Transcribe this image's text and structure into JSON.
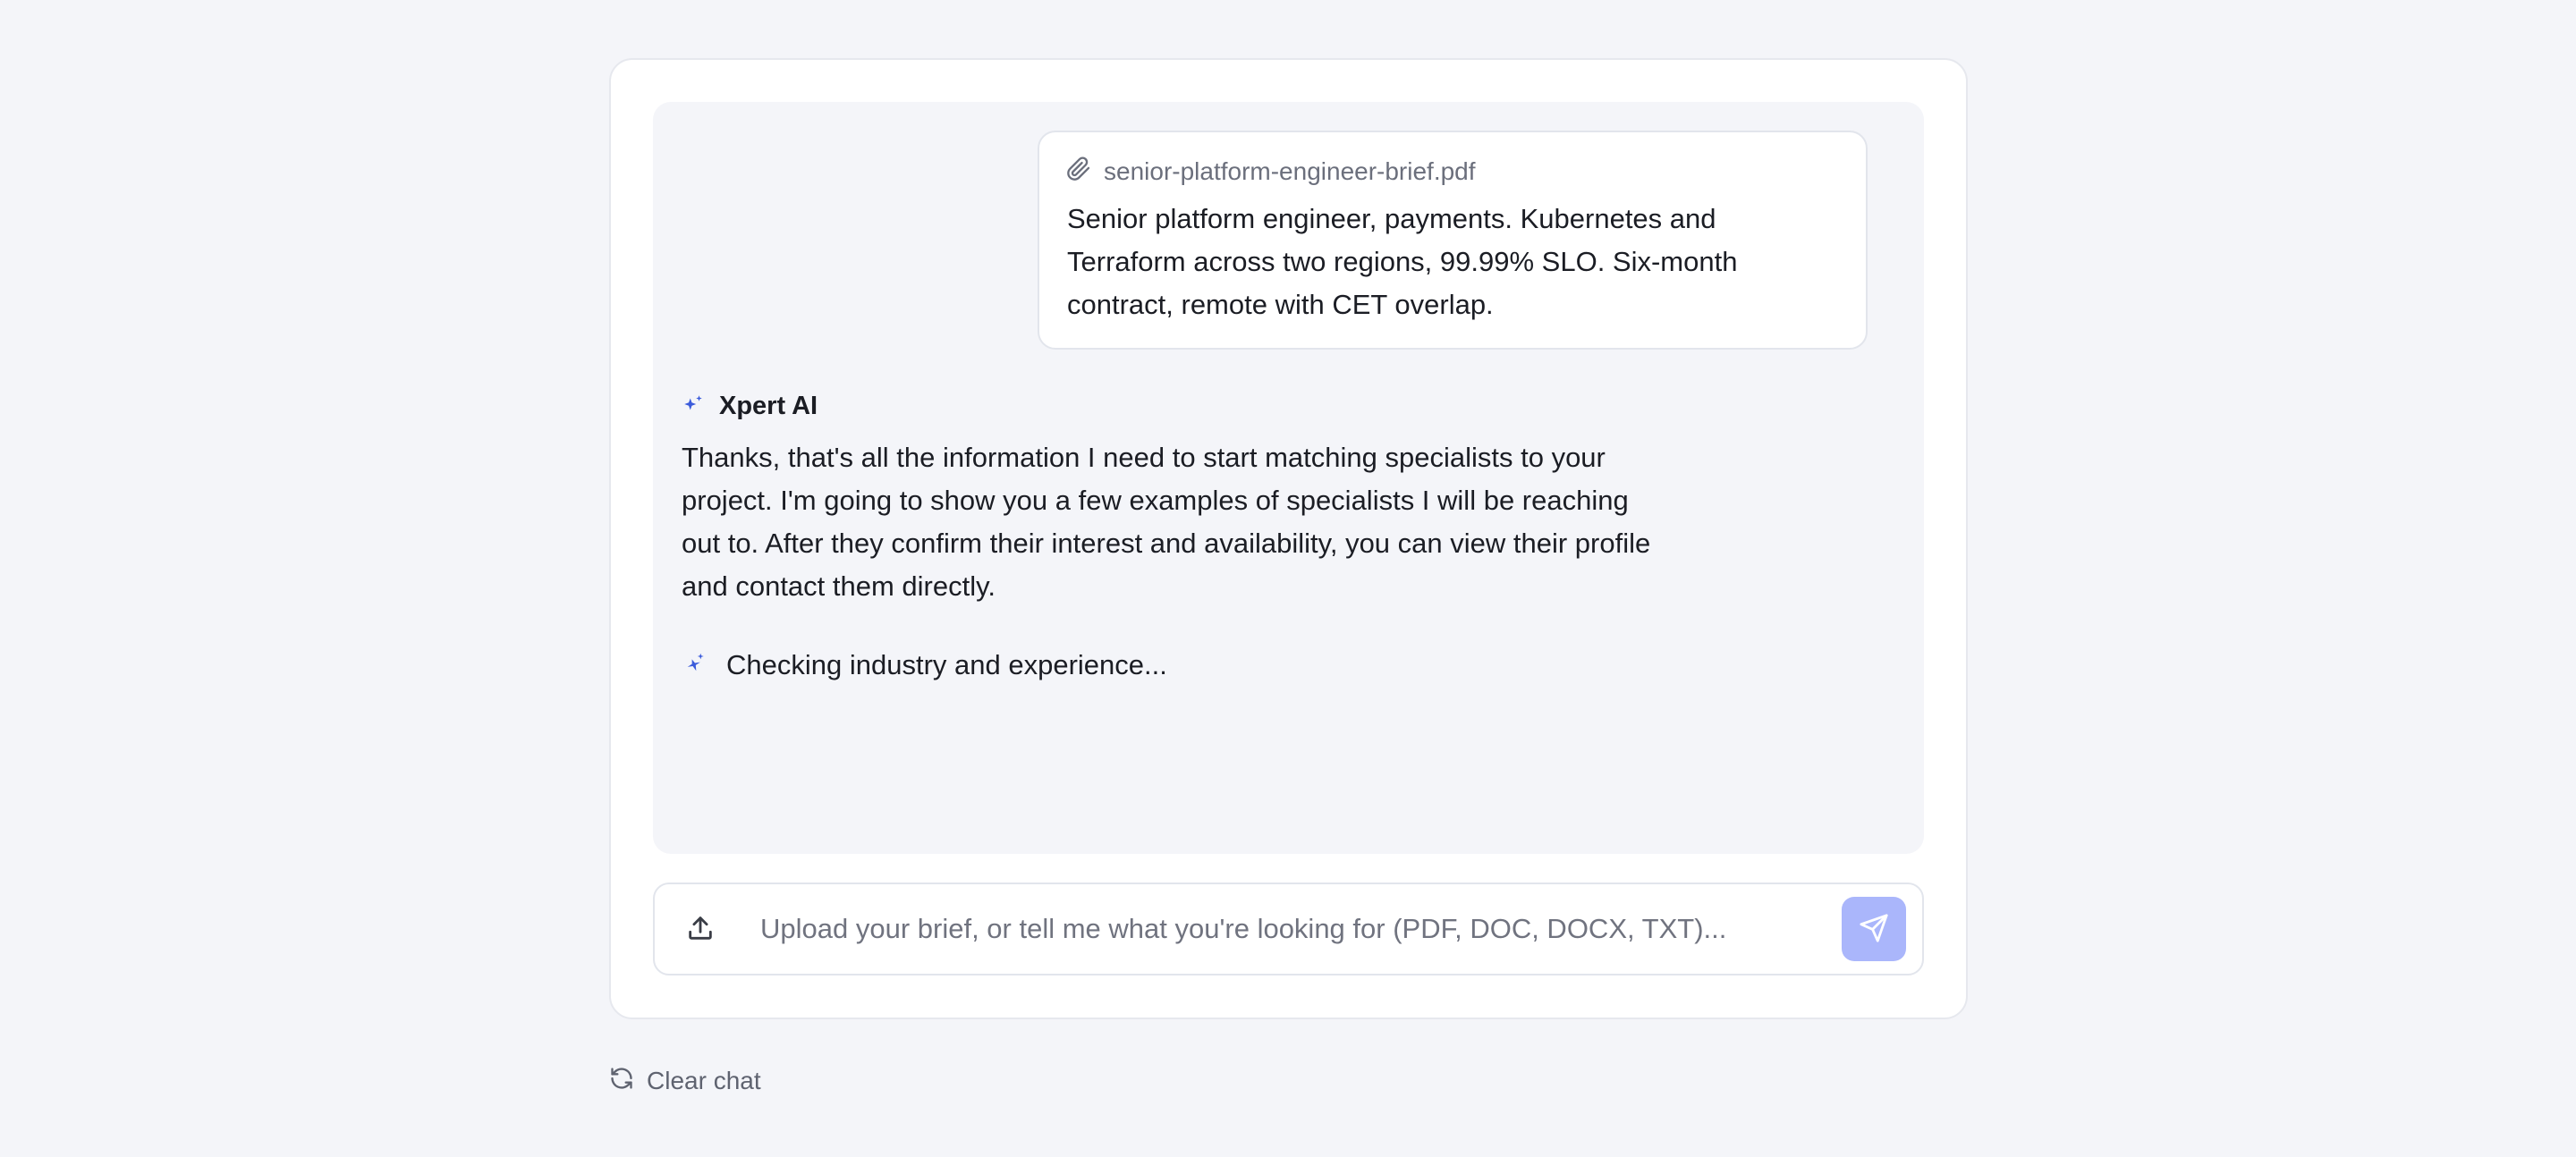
{
  "conversation": {
    "user_message": {
      "attachment_name": "senior-platform-engineer-brief.pdf",
      "attachment_icon": "paperclip-icon",
      "text": "Senior platform engineer, payments. Kubernetes and Terraform across two regions, 99.99% SLO. Six-month contract, remote with CET overlap."
    },
    "assistant": {
      "name": "Xpert AI",
      "icon": "sparkle-icon",
      "text": "Thanks, that's all the information I need to start matching specialists to your project. I'm going to show you a few examples of specialists I will be reaching out to. After they confirm their interest and availability, you can view their profile and contact them directly.",
      "status_text": "Checking industry and experience...",
      "status_icon": "loading-sparkle-icon"
    }
  },
  "composer": {
    "placeholder": "Upload your brief, or tell me what you're looking for (PDF, DOC, DOCX, TXT)...",
    "value": "",
    "upload_icon": "upload-icon",
    "send_icon": "send-icon"
  },
  "footer": {
    "clear_label": "Clear chat",
    "clear_icon": "refresh-icon"
  },
  "colors": {
    "accent": "#3b5bdb",
    "send_button": "#aab6fb",
    "background": "#f4f5f9"
  }
}
